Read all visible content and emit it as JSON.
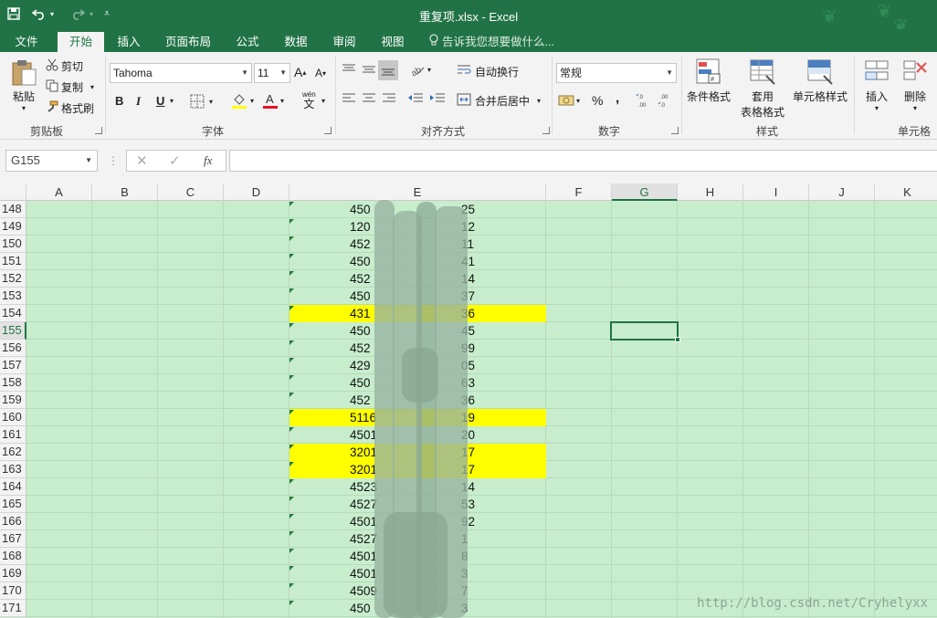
{
  "window": {
    "title": "重复项.xlsx - Excel"
  },
  "tabs": [
    {
      "label": "文件"
    },
    {
      "label": "开始"
    },
    {
      "label": "插入"
    },
    {
      "label": "页面布局"
    },
    {
      "label": "公式"
    },
    {
      "label": "数据"
    },
    {
      "label": "审阅"
    },
    {
      "label": "视图"
    }
  ],
  "tell_me": "告诉我您想要做什么...",
  "ribbon": {
    "clipboard": {
      "paste": "粘贴",
      "cut": "剪切",
      "copy": "复制",
      "format_painter": "格式刷",
      "label": "剪贴板"
    },
    "font": {
      "name": "Tahoma",
      "size": "11",
      "bold": "B",
      "italic": "I",
      "underline": "U",
      "label": "字体",
      "wen": "wén",
      "wen_char": "文"
    },
    "alignment": {
      "wrap": "自动换行",
      "merge": "合并后居中",
      "label": "对齐方式"
    },
    "number": {
      "format": "常规",
      "percent": "%",
      "comma": ",",
      "label": "数字"
    },
    "styles": {
      "conditional": "条件格式",
      "table1": "套用",
      "table2": "表格格式",
      "cell_styles": "单元格样式",
      "label": "样式"
    },
    "cells": {
      "insert": "插入",
      "delete": "删除",
      "label": "单元格"
    }
  },
  "formula_bar": {
    "name_box": "G155",
    "fx": "fx",
    "formula": ""
  },
  "columns": [
    "A",
    "B",
    "C",
    "D",
    "E",
    "F",
    "G",
    "H",
    "I",
    "J",
    "K"
  ],
  "selected_column": "G",
  "selected_row": "155",
  "rows": [
    {
      "num": "148",
      "left": "450",
      "right": "25",
      "highlight": false
    },
    {
      "num": "149",
      "left": "120",
      "right": "12",
      "highlight": false
    },
    {
      "num": "150",
      "left": "452",
      "right": "11",
      "highlight": false
    },
    {
      "num": "151",
      "left": "450",
      "right": "41",
      "highlight": false
    },
    {
      "num": "152",
      "left": "452",
      "right": "14",
      "highlight": false
    },
    {
      "num": "153",
      "left": "450",
      "right": "37",
      "highlight": false
    },
    {
      "num": "154",
      "left": "431",
      "right": "36",
      "highlight": true
    },
    {
      "num": "155",
      "left": "450",
      "right": "45",
      "highlight": false
    },
    {
      "num": "156",
      "left": "452",
      "right": "99",
      "highlight": false
    },
    {
      "num": "157",
      "left": "429",
      "right": "05",
      "highlight": false
    },
    {
      "num": "158",
      "left": "450",
      "right": "63",
      "highlight": false
    },
    {
      "num": "159",
      "left": "452",
      "right": "36",
      "highlight": false
    },
    {
      "num": "160",
      "left": "5116",
      "right": "19",
      "highlight": true
    },
    {
      "num": "161",
      "left": "4501",
      "right": "20",
      "highlight": false
    },
    {
      "num": "162",
      "left": "3201",
      "right": "17",
      "highlight": true
    },
    {
      "num": "163",
      "left": "3201",
      "right": "17",
      "highlight": true
    },
    {
      "num": "164",
      "left": "4523",
      "right": "14",
      "highlight": false
    },
    {
      "num": "165",
      "left": "4527",
      "right": "53",
      "highlight": false
    },
    {
      "num": "166",
      "left": "4501",
      "right": "92",
      "highlight": false
    },
    {
      "num": "167",
      "left": "4527",
      "right": "1",
      "highlight": false
    },
    {
      "num": "168",
      "left": "4501",
      "right": "8",
      "highlight": false
    },
    {
      "num": "169",
      "left": "4501",
      "right": "3",
      "highlight": false
    },
    {
      "num": "170",
      "left": "4509",
      "right": "7",
      "highlight": false
    },
    {
      "num": "171",
      "left": "450",
      "right": "3",
      "highlight": false
    }
  ],
  "colors": {
    "excel_green": "#217346",
    "sheet_bg": "#c7edcc",
    "highlight": "#ffff00"
  },
  "watermark": "http://blog.csdn.net/Cryhelyxx"
}
